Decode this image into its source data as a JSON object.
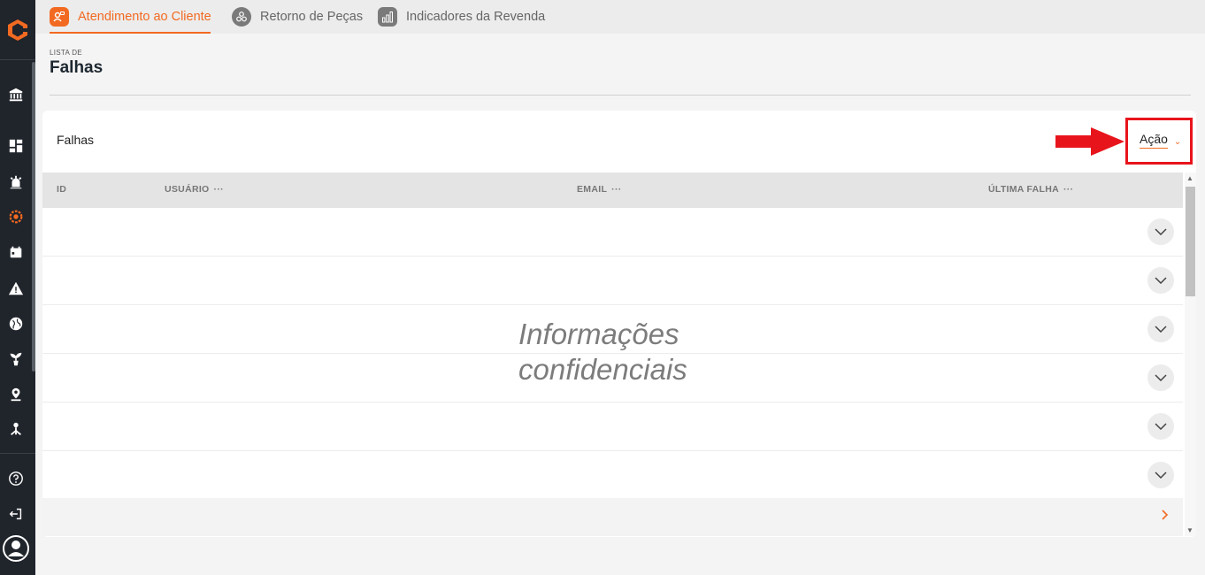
{
  "tabs": [
    {
      "label": "Atendimento ao Cliente",
      "icon": "customer-service-icon",
      "active": true
    },
    {
      "label": "Retorno de Peças",
      "icon": "parts-return-icon",
      "active": false
    },
    {
      "label": "Indicadores da Revenda",
      "icon": "bar-chart-icon",
      "active": false
    }
  ],
  "header": {
    "pretitle": "LISTA DE",
    "title": "Falhas"
  },
  "card": {
    "title": "Falhas",
    "action_label": "Ação"
  },
  "table": {
    "columns": [
      {
        "label": "ID"
      },
      {
        "label": "USUÁRIO",
        "menu": "···"
      },
      {
        "label": "EMAIL",
        "menu": "···"
      },
      {
        "label": "ÚLTIMA FALHA",
        "menu": "···"
      }
    ]
  },
  "overlay_text": [
    "Informações",
    "confidenciais"
  ],
  "colors": {
    "accent": "#f26a21",
    "sidebar": "#20242b",
    "highlight": "#e8141c"
  }
}
